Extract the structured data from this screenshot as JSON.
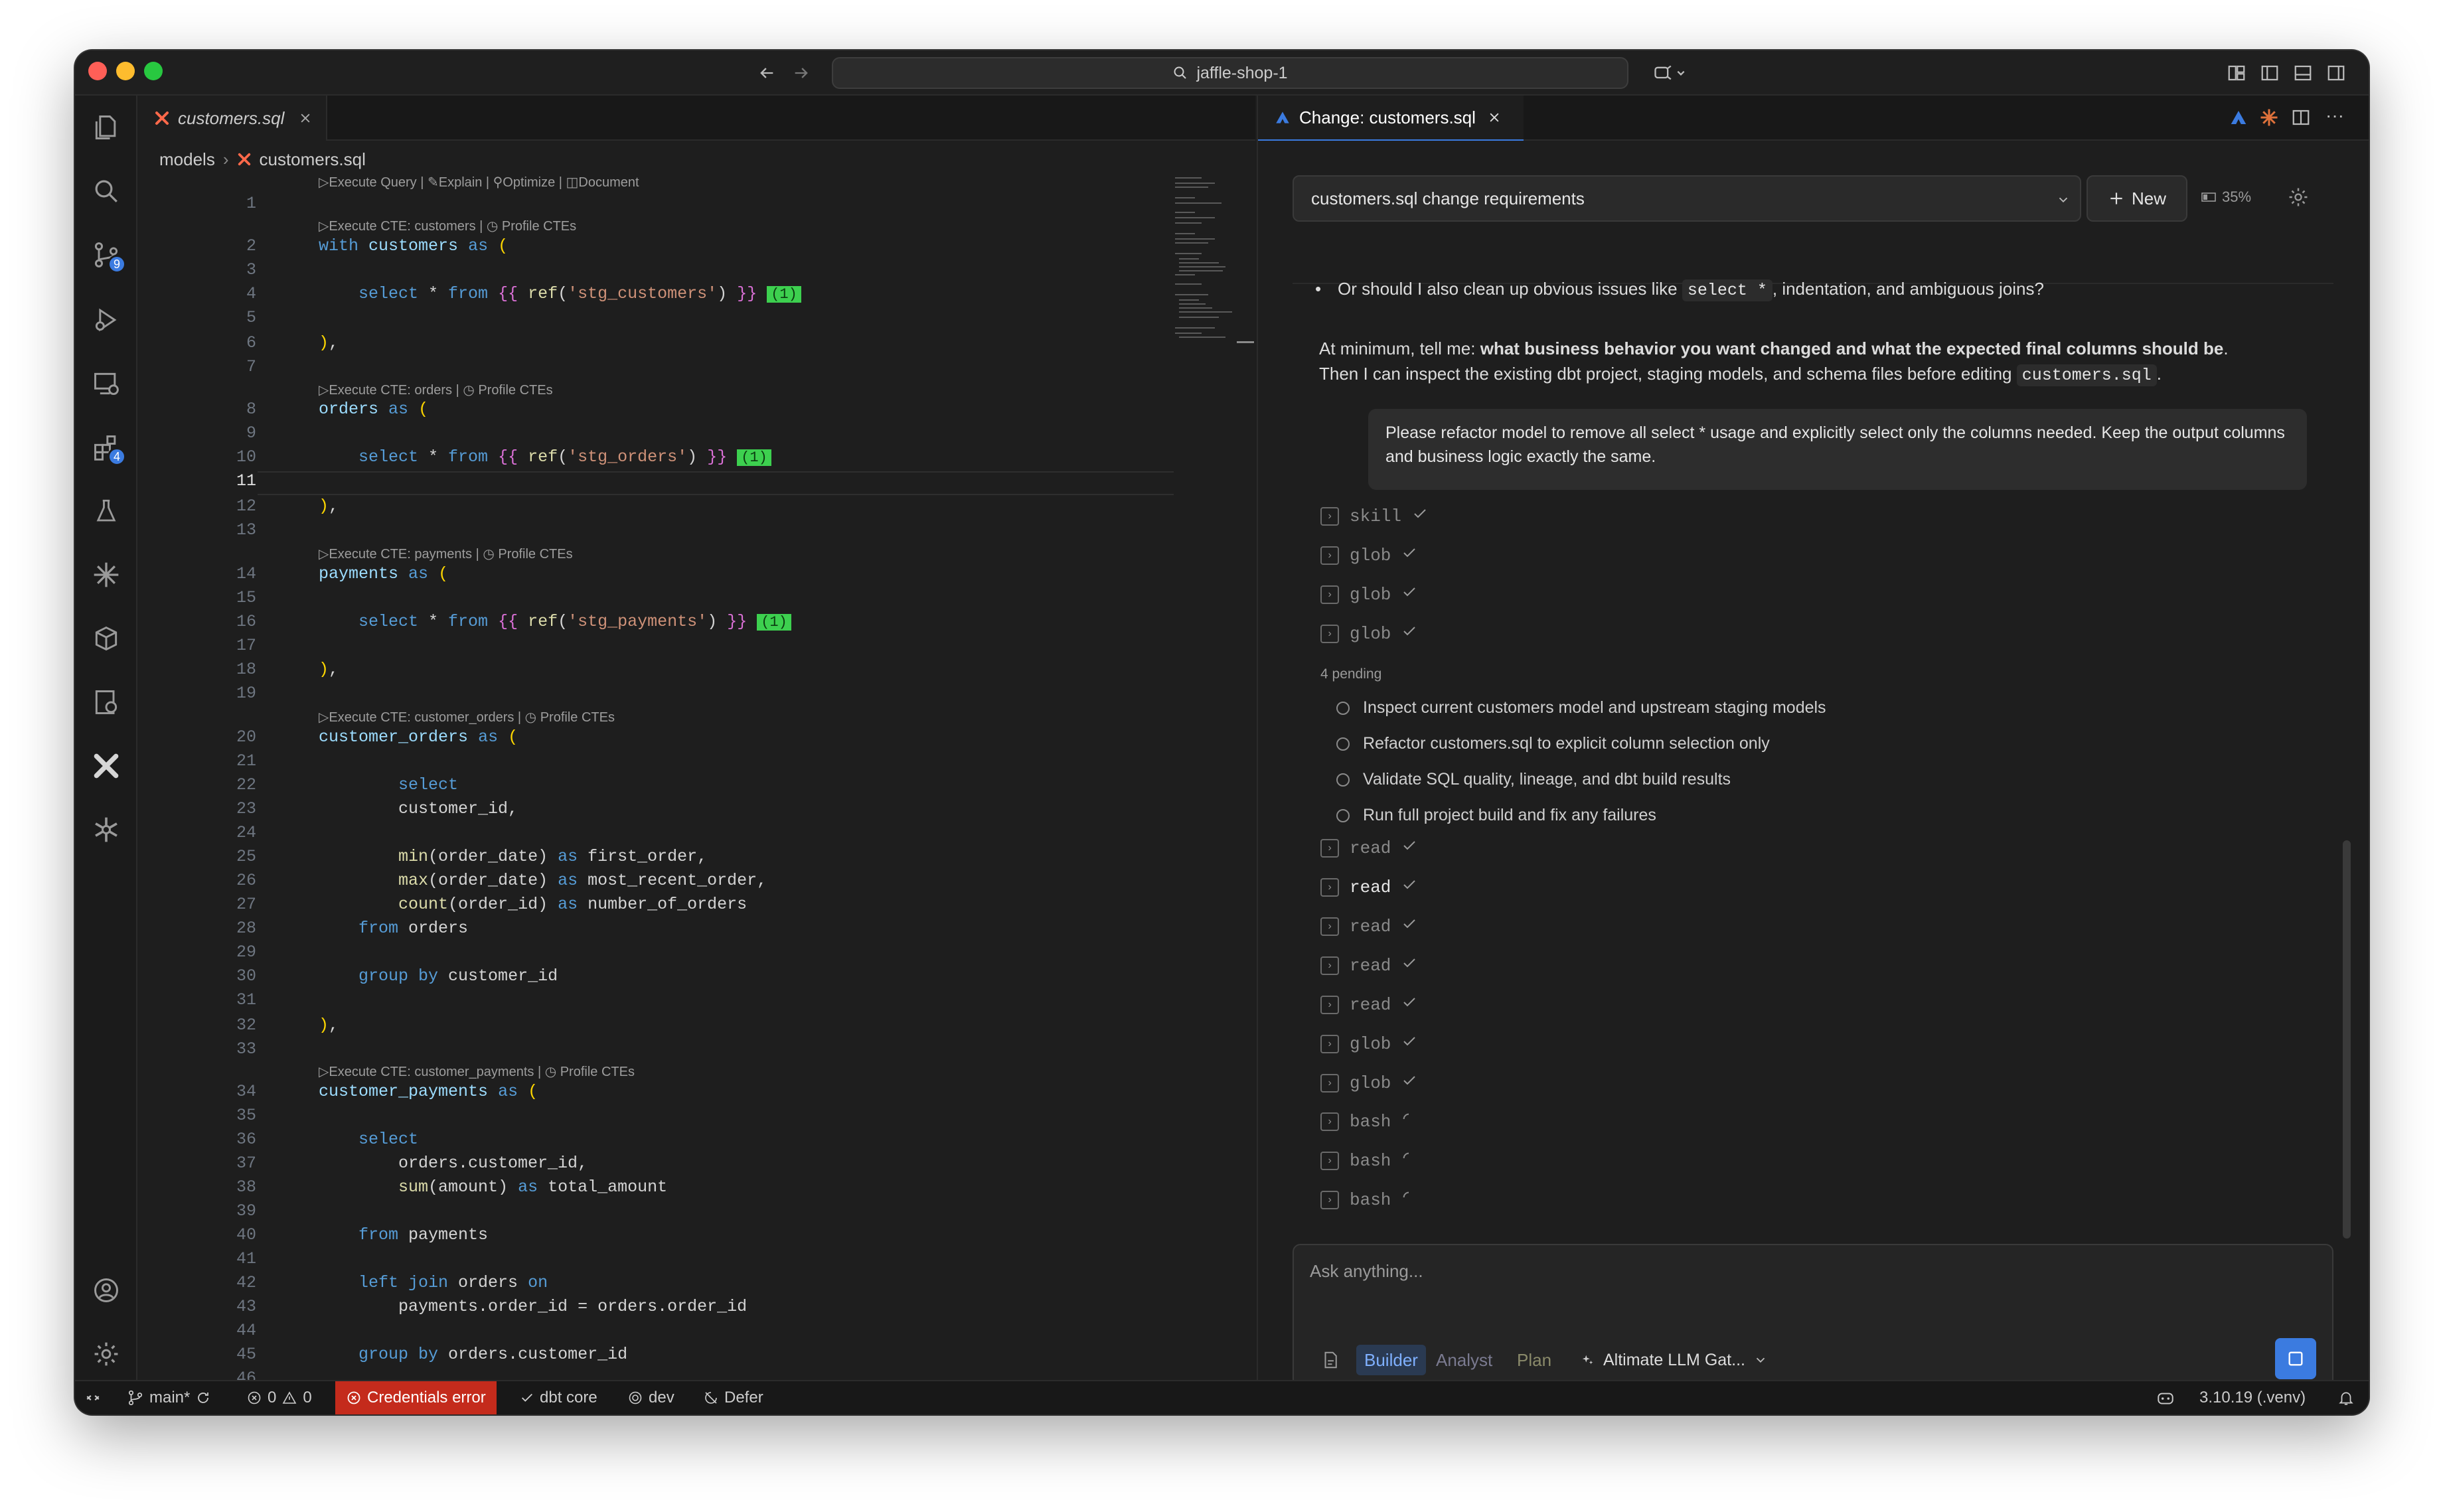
{
  "titlebar": {
    "search_text": "jaffle-shop-1"
  },
  "activity_badges": {
    "scm": "9",
    "extensions": "4"
  },
  "editor": {
    "tab_label": "customers.sql",
    "breadcrumb": {
      "folder": "models",
      "file": "customers.sql"
    },
    "top_lens": "▷Execute Query | ✎Explain | ⚲Optimize | ◫Document",
    "lenses": [
      "▷Execute CTE: customers | ◷ Profile CTEs",
      "▷Execute CTE: orders | ◷ Profile CTEs",
      "▷Execute CTE: payments | ◷ Profile CTEs",
      "▷Execute CTE: customer_orders | ◷ Profile CTEs",
      "▷Execute CTE: customer_payments | ◷ Profile CTEs"
    ],
    "line_numbers": [
      "1",
      "2",
      "3",
      "4",
      "5",
      "6",
      "7",
      "8",
      "9",
      "10",
      "11",
      "12",
      "13",
      "14",
      "15",
      "16",
      "17",
      "18",
      "19",
      "20",
      "21",
      "22",
      "23",
      "24",
      "25",
      "26",
      "27",
      "28",
      "29",
      "30",
      "31",
      "32",
      "33",
      "34",
      "35",
      "36",
      "37",
      "38",
      "39",
      "40",
      "41",
      "42",
      "43",
      "44",
      "45",
      "46"
    ],
    "current_line": "11",
    "hint_label": "(1)"
  },
  "chat": {
    "tab_label": "Change: customers.sql",
    "session_title": "customers.sql change requirements",
    "new_label": "New",
    "context_pct": "35%",
    "assistant": {
      "bullet_a": "Or should I also clean up obvious issues like ",
      "bullet_code": "select *",
      "bullet_b": ", indentation, and ambiguous joins?",
      "p1_a": "At minimum, tell me: ",
      "p1_bold": "what business behavior you want changed and what the expected final columns should be",
      "p1_b": ".",
      "p2_a": "Then I can inspect the existing dbt project, staging models, and schema files before editing ",
      "p2_code": "customers.sql",
      "p2_b": "."
    },
    "user_message": "Please refactor model to remove all select * usage and explicitly select only the columns needed. Keep the output columns and business logic exactly the same.",
    "tools_top": [
      "skill",
      "glob",
      "glob",
      "glob"
    ],
    "pending_label": "4 pending",
    "todos": [
      "Inspect current customers model and upstream staging models",
      "Refactor customers.sql to explicit column selection only",
      "Validate SQL quality, lineage, and dbt build results",
      "Run full project build and fix any failures"
    ],
    "tools_bottom": [
      "read",
      "read",
      "read",
      "read",
      "read",
      "glob",
      "glob",
      "bash",
      "bash",
      "bash"
    ],
    "composer": {
      "placeholder": "Ask anything...",
      "mode_builder": "Builder",
      "mode_analyst": "Analyst",
      "mode_plan": "Plan",
      "model": "Altimate LLM Gat..."
    }
  },
  "statusbar": {
    "branch": "main*",
    "errors": "0",
    "warnings": "0",
    "credentials": "Credentials error",
    "dbt": "dbt core",
    "target": "dev",
    "defer": "Defer",
    "python": "3.10.19 (.venv)"
  },
  "colors": {
    "accent": "#3b7be0",
    "error_bg": "#c42b1c",
    "hint": "#3dd04f",
    "dbt": "#ff694a"
  }
}
